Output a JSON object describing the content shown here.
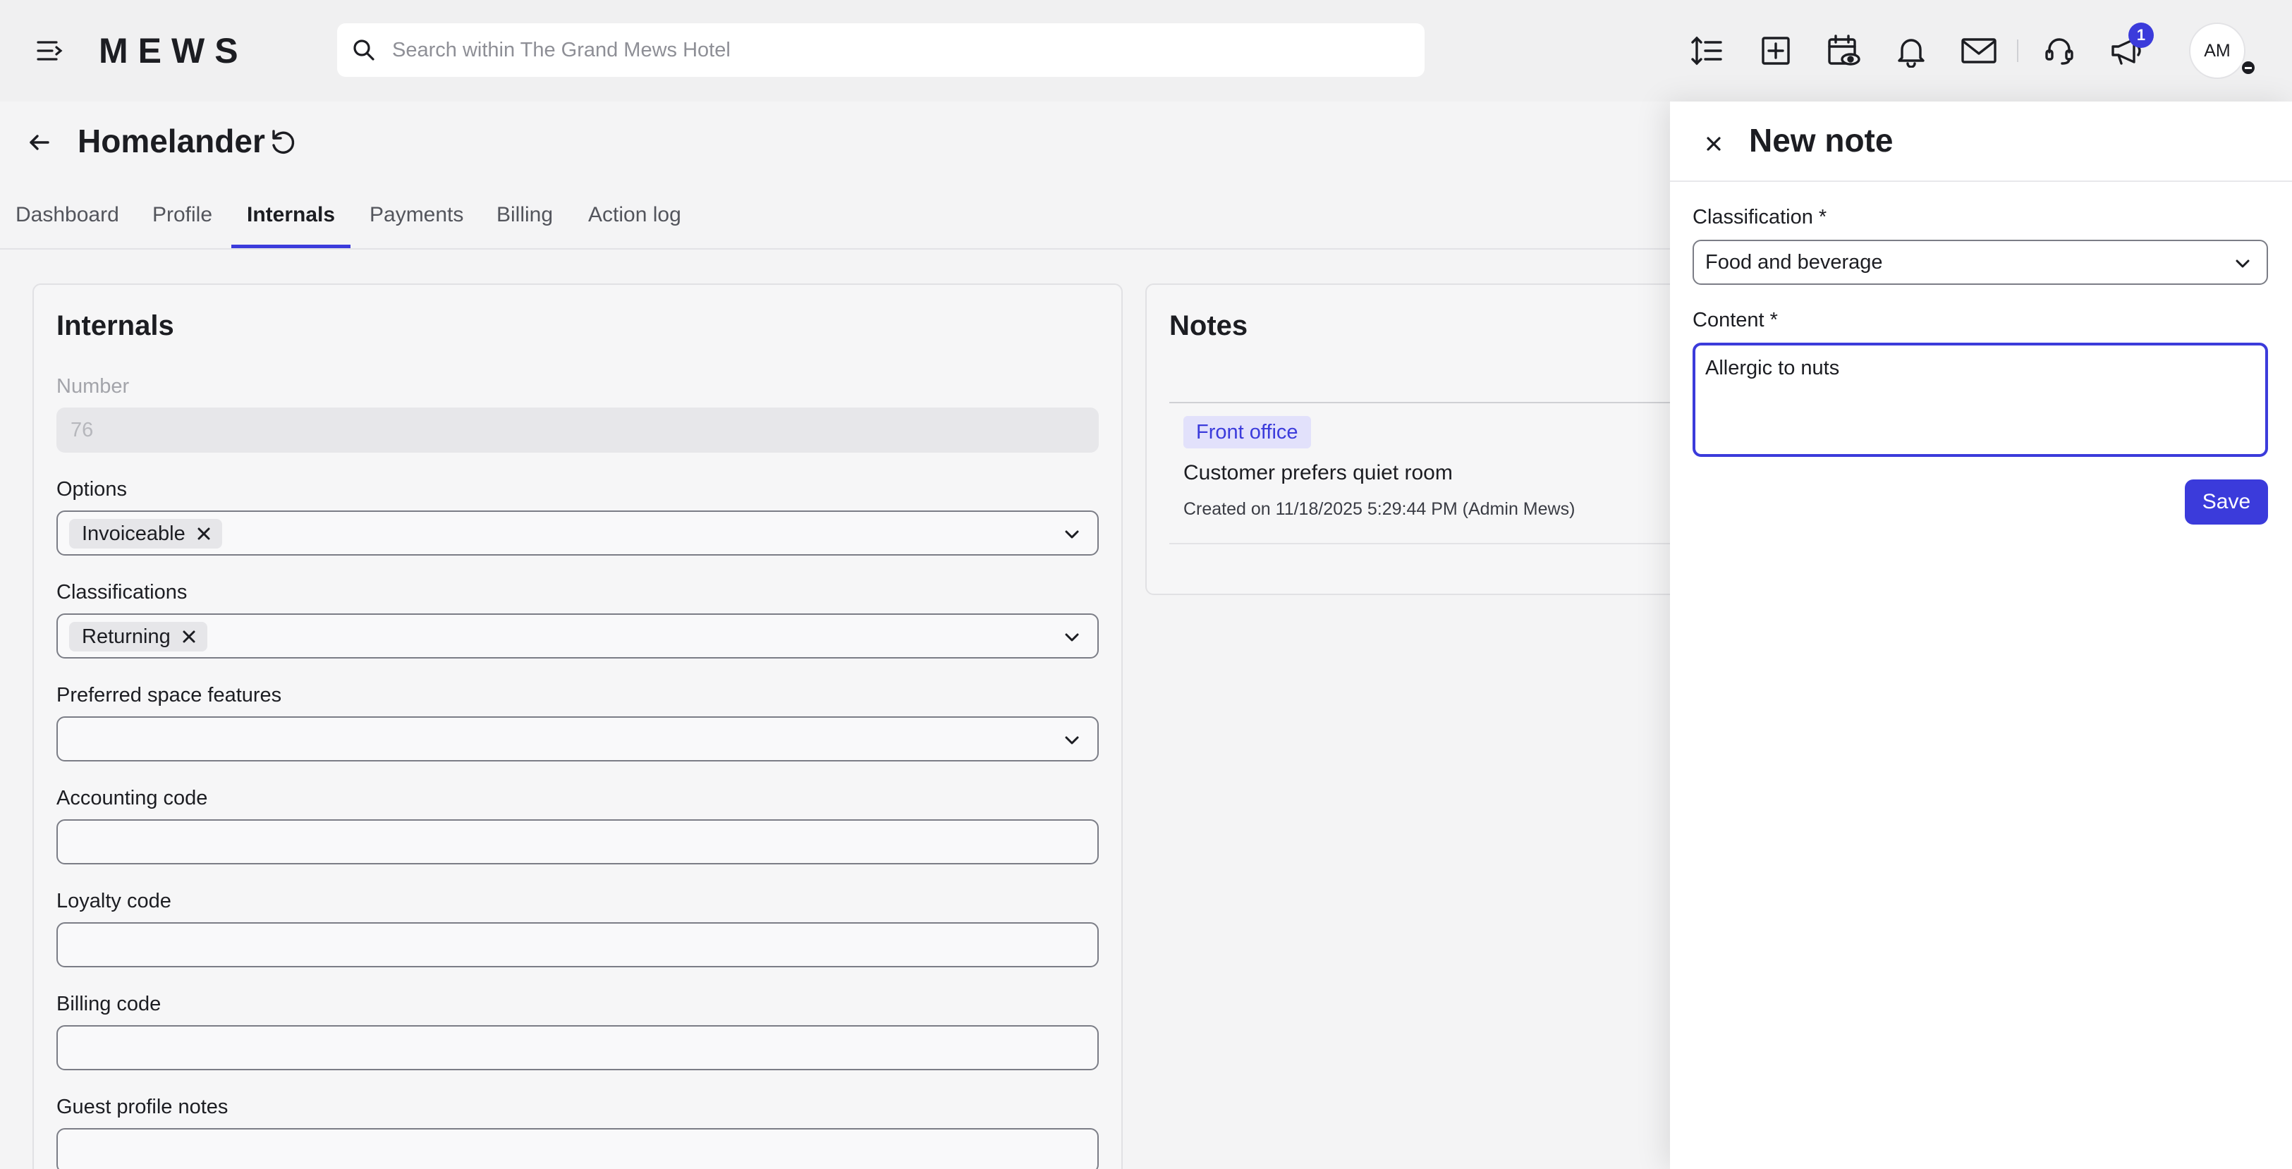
{
  "app": {
    "logo": "MEWS"
  },
  "search": {
    "placeholder": "Search within The Grand Mews Hotel"
  },
  "topbar": {
    "icons": [
      "sort-lines-icon",
      "add-square-icon",
      "calendar-view-icon",
      "bell-icon",
      "mail-icon",
      "support-headset-icon",
      "megaphone-icon"
    ],
    "notification_count": "1",
    "avatar_initials": "AM"
  },
  "page": {
    "title": "Homelander"
  },
  "tabs": [
    {
      "label": "Dashboard"
    },
    {
      "label": "Profile"
    },
    {
      "label": "Internals",
      "active": true
    },
    {
      "label": "Payments"
    },
    {
      "label": "Billing"
    },
    {
      "label": "Action log"
    }
  ],
  "internals": {
    "title": "Internals",
    "number_label": "Number",
    "number_value": "76",
    "options_label": "Options",
    "options_chip": "Invoiceable",
    "classifications_label": "Classifications",
    "classifications_chip": "Returning",
    "space_features_label": "Preferred space features",
    "accounting_label": "Accounting code",
    "loyalty_label": "Loyalty code",
    "billing_label": "Billing code",
    "guest_notes_label": "Guest profile notes"
  },
  "notes": {
    "title": "Notes",
    "items": [
      {
        "tag": "Front office",
        "text": "Customer prefers quiet room",
        "meta": "Created on 11/18/2025 5:29:44 PM (Admin Mews)"
      }
    ]
  },
  "panel": {
    "title": "New note",
    "classification_label": "Classification *",
    "classification_value": "Food and beverage",
    "content_label": "Content *",
    "content_value": "Allergic to nuts",
    "save_label": "Save"
  },
  "colors": {
    "accent": "#3b3bdb",
    "tag_bg": "#e2e1fb"
  }
}
